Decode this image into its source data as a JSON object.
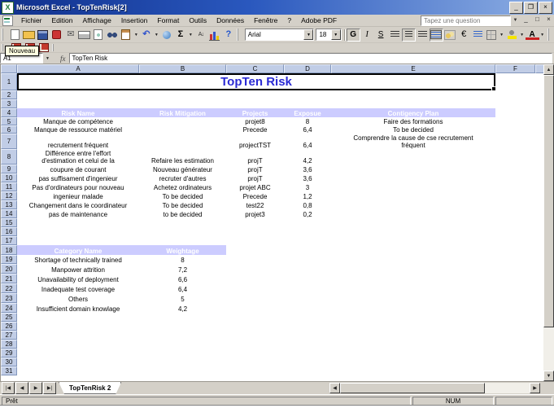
{
  "window": {
    "title": "Microsoft Excel - TopTenRisk[2]"
  },
  "menu": {
    "items": [
      "Fichier",
      "Edition",
      "Affichage",
      "Insertion",
      "Format",
      "Outils",
      "Données",
      "Fenêtre",
      "?",
      "Adobe PDF"
    ],
    "question_box": "Tapez une question"
  },
  "toolbars": {
    "standard_icons": [
      {
        "name": "new-document"
      },
      {
        "name": "open-folder"
      },
      {
        "name": "save"
      },
      {
        "name": "permission"
      },
      {
        "name": "mail",
        "glyph": "✉"
      },
      {
        "name": "print"
      },
      {
        "name": "print-preview"
      },
      {
        "name": "search"
      },
      {
        "name": "paste",
        "dd": true
      },
      {
        "name": "undo",
        "glyph": "↶",
        "dd": true
      },
      {
        "name": "hyperlink"
      },
      {
        "name": "autosum",
        "glyph": "Σ",
        "dd": true
      },
      {
        "name": "sort-ascending",
        "glyph": "A↓"
      },
      {
        "name": "chart-wizard"
      },
      {
        "name": "help",
        "glyph": "?"
      }
    ],
    "font_name": "Arial",
    "font_size": "18",
    "formatting_icons": [
      {
        "name": "bold",
        "glyph": "G",
        "pressed": true
      },
      {
        "name": "italic",
        "glyph": "I"
      },
      {
        "name": "underline",
        "glyph": "S"
      },
      {
        "name": "align-left",
        "stripes": true
      },
      {
        "name": "align-center",
        "stripes": true,
        "pressed": true
      },
      {
        "name": "align-right",
        "stripes": true
      },
      {
        "name": "merge-center",
        "pressed": true
      },
      {
        "name": "currency-style"
      },
      {
        "name": "euro",
        "glyph": "€"
      },
      {
        "name": "increase-indent"
      },
      {
        "name": "borders",
        "dd": true
      },
      {
        "name": "fill-color",
        "dd": true
      },
      {
        "name": "font-color",
        "glyph": "A",
        "dd": true
      }
    ],
    "pdf_icons": [
      {
        "name": "convert-to-pdf"
      },
      {
        "name": "convert-pdf-email"
      },
      {
        "name": "convert-pdf-review"
      }
    ]
  },
  "tooltip": {
    "text": "Nouveau"
  },
  "formula_bar": {
    "name_box": "A1",
    "fx_label": "fx",
    "value": "TopTen Risk"
  },
  "sheet": {
    "column_letters": [
      "A",
      "B",
      "C",
      "D",
      "E",
      "F"
    ],
    "last_row": 31,
    "title_row": {
      "row": 1,
      "text": "TopTen Risk",
      "span": "A:E"
    },
    "band_rows": {
      "4": "A:E",
      "18": "A:B"
    },
    "cells": {
      "4": {
        "A": "Risk Name",
        "B": "Risk Mitigation",
        "C": "Projects",
        "D": "Exposue",
        "E": "Contigency Plan"
      },
      "5": {
        "A": "Manque de compétence",
        "C": "projet8",
        "D": "8",
        "E": "Faire des formations"
      },
      "6": {
        "A": "Manque de ressource matériel",
        "C": "Precede",
        "D": "6,4",
        "E": "To be decided"
      },
      "7": {
        "A": "recrutement fréquent",
        "C": "projectTST",
        "D": "6,4",
        "E": "Comprendre la cause de cse recrutement\nfréquent"
      },
      "8": {
        "A": "Différence entre l'effort\nd'estimation et celui de la",
        "B": "Refaire les estimation",
        "C": "projT",
        "D": "4,2"
      },
      "9": {
        "A": "coupure de courant",
        "B": "Nouveau générateur",
        "C": "projT",
        "D": "3,6"
      },
      "10": {
        "A": "pas suffisament d'ingenieur",
        "B": "recruter d'autres",
        "C": "projT",
        "D": "3,6"
      },
      "11": {
        "A": "Pas d'ordinateurs pour nouveau",
        "B": "Achetez ordinateurs",
        "C": "projet ABC",
        "D": "3"
      },
      "12": {
        "A": "ingenieur malade",
        "B": "To be decided",
        "C": "Precede",
        "D": "1,2"
      },
      "13": {
        "A": "Changement dans le coordinateur",
        "B": "To be decided",
        "C": "test22",
        "D": "0,8"
      },
      "14": {
        "A": "pas de maintenance",
        "B": "to be decided",
        "C": "projet3",
        "D": "0,2"
      },
      "18": {
        "A": "Category Name",
        "B": "Weightage"
      },
      "19": {
        "A": "Shortage of technically trained",
        "B": "8"
      },
      "20": {
        "A": "Manpower attrition",
        "B": "7,2"
      },
      "21": {
        "A": "Unavailability of deployment",
        "B": "6,6"
      },
      "22": {
        "A": "Inadequate test coverage",
        "B": "6,4"
      },
      "23": {
        "A": "Others",
        "B": "5"
      },
      "24": {
        "A": "Insufficient domain knowlage",
        "B": "4,2"
      }
    }
  },
  "tabs": {
    "active": "TopTenRisk 2"
  },
  "status": {
    "left": "Prêt",
    "num": "NUM"
  },
  "colors": {
    "band_background": "#ccccff",
    "title_text": "#2b2bd4",
    "header_fill": "#c1cde6",
    "titlebar_start": "#10308c",
    "titlebar_end": "#8fb0e4"
  }
}
